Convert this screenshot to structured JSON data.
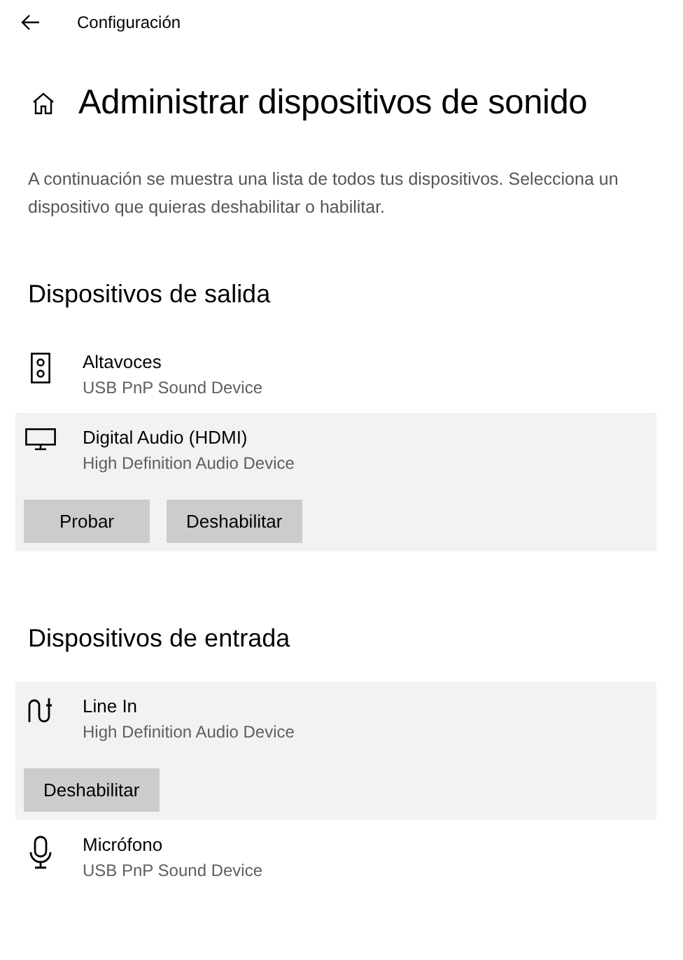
{
  "window": {
    "title": "Configuración"
  },
  "page": {
    "title": "Administrar dispositivos de sonido",
    "description": "A continuación se muestra una lista de todos tus dispositivos. Selecciona un dispositivo que quieras deshabilitar o habilitar."
  },
  "sections": [
    {
      "title": "Dispositivos de salida",
      "devices": [
        {
          "kind": "speaker",
          "name": "Altavoces",
          "detail": "USB PnP Sound Device",
          "selected": false
        },
        {
          "kind": "monitor",
          "name": "Digital Audio (HDMI)",
          "detail": "High Definition Audio Device",
          "selected": true,
          "buttons": [
            "Probar",
            "Deshabilitar"
          ]
        }
      ]
    },
    {
      "title": "Dispositivos de entrada",
      "devices": [
        {
          "kind": "line-in",
          "name": "Line In",
          "detail": "High Definition Audio Device",
          "selected": true,
          "buttons": [
            "Deshabilitar"
          ]
        },
        {
          "kind": "microphone",
          "name": "Micrófono",
          "detail": "USB PnP Sound Device",
          "selected": false
        }
      ]
    }
  ]
}
